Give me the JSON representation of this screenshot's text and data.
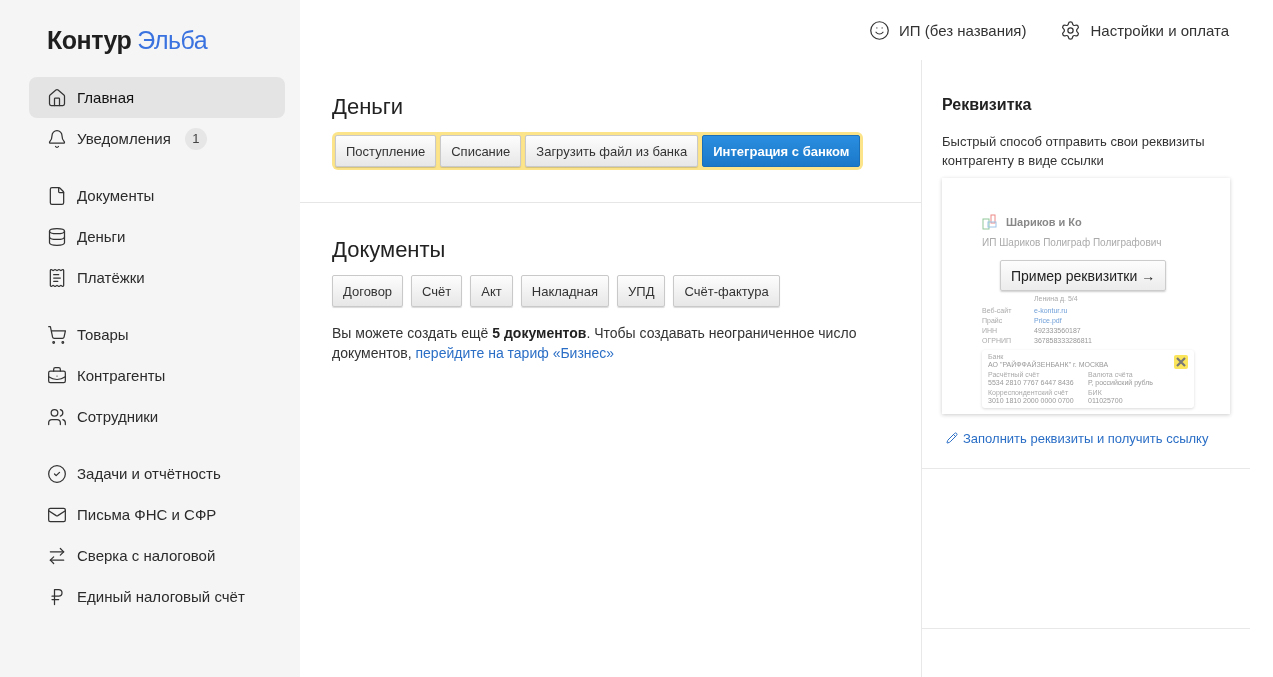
{
  "logo": {
    "part_1": "Контур",
    "part_2": "Эльба"
  },
  "header": {
    "account": "ИП (без названия)",
    "settings": "Настройки и оплата"
  },
  "sidebar": {
    "groups": [
      {
        "items": [
          {
            "label": "Главная",
            "selected": true
          },
          {
            "label": "Уведомления",
            "selected": false,
            "badge": "1"
          }
        ]
      },
      {
        "items": [
          {
            "label": "Документы",
            "selected": false
          },
          {
            "label": "Деньги",
            "selected": false
          },
          {
            "label": "Платёжки",
            "selected": false
          }
        ]
      },
      {
        "items": [
          {
            "label": "Товары",
            "selected": false
          },
          {
            "label": "Контрагенты",
            "selected": false
          },
          {
            "label": "Сотрудники",
            "selected": false
          }
        ]
      },
      {
        "items": [
          {
            "label": "Задачи и отчётность",
            "selected": false
          },
          {
            "label": "Письма ФНС и СФР",
            "selected": false
          },
          {
            "label": "Сверка с налоговой",
            "selected": false
          },
          {
            "label": "Единый налоговый счёт",
            "selected": false
          }
        ]
      }
    ]
  },
  "money": {
    "title": "Деньги",
    "highlighted": true,
    "buttons": [
      {
        "label": "Поступление",
        "kind": "default"
      },
      {
        "label": "Списание",
        "kind": "default"
      },
      {
        "label": "Загрузить файл из банка",
        "kind": "default"
      },
      {
        "label": "Интеграция с банком",
        "kind": "primary"
      }
    ]
  },
  "documents": {
    "title": "Документы",
    "buttons": [
      "Договор",
      "Счёт",
      "Акт",
      "Накладная",
      "УПД",
      "Счёт-фактура"
    ],
    "note": "Вы можете создать ещё **5 документов**. Чтобы создавать неограниченное число документов,",
    "note_link": "перейдите на тариф «Бизнес»"
  },
  "requisites": {
    "title": "Реквизитка",
    "description": "Быстрый способ отправить свои реквизиты контрагенту в виде ссылки",
    "preview": {
      "company": "Шариков и Ко",
      "owner": "ИП Шариков Полиграф Полиграфович",
      "address_tail": "Ленина д. 5/4",
      "rows": [
        {
          "label": "Веб-сайт",
          "value": "e-kontur.ru",
          "link": true
        },
        {
          "label": "Прайс",
          "value": "Price.pdf",
          "link": true
        },
        {
          "label": "ИНН",
          "value": "492333560187",
          "link": false
        },
        {
          "label": "ОГРНИП",
          "value": "367858333286811",
          "link": false
        }
      ],
      "bank": {
        "label": "Банк",
        "name": "АО \"РАЙФФАЙЗЕНБАНК\" г. МОСКВА",
        "fields": [
          {
            "label": "Расчётный счёт",
            "value": "5534  2810  7767  6447  8436"
          },
          {
            "label": "Валюта счёта",
            "value": "Р, российский рубль"
          },
          {
            "label": "Корреспондентский счёт",
            "value": "3010  1810  2000  0000  0700"
          },
          {
            "label": "БИК",
            "value": "011025700"
          }
        ]
      },
      "button": "Пример реквизитки →"
    },
    "link": "Заполнить реквизиты и получить ссылку"
  }
}
